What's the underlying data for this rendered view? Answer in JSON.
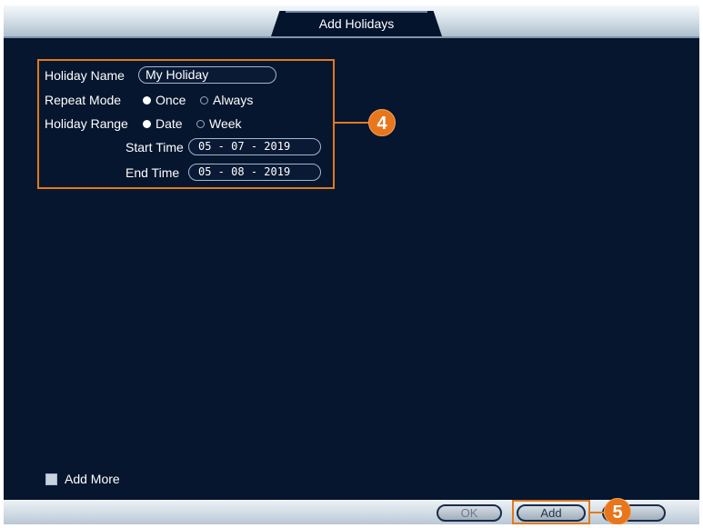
{
  "window": {
    "title": "Add Holidays"
  },
  "form": {
    "holiday_name": {
      "label": "Holiday Name",
      "value": "My Holiday"
    },
    "repeat_mode": {
      "label": "Repeat Mode",
      "options": [
        "Once",
        "Always"
      ],
      "selected": "Once"
    },
    "holiday_range": {
      "label": "Holiday Range",
      "options": [
        "Date",
        "Week"
      ],
      "selected": "Date"
    },
    "start_time": {
      "label": "Start Time",
      "month": "05",
      "day": "07",
      "year": "2019"
    },
    "end_time": {
      "label": "End Time",
      "month": "05",
      "day": "08",
      "year": "2019"
    }
  },
  "add_more": {
    "label": "Add More",
    "checked": false
  },
  "buttons": {
    "ok": "OK",
    "add": "Add"
  },
  "callouts": {
    "step4": "4",
    "step5": "5"
  },
  "colors": {
    "background": "#06162e",
    "accent": "#e07a1f"
  }
}
